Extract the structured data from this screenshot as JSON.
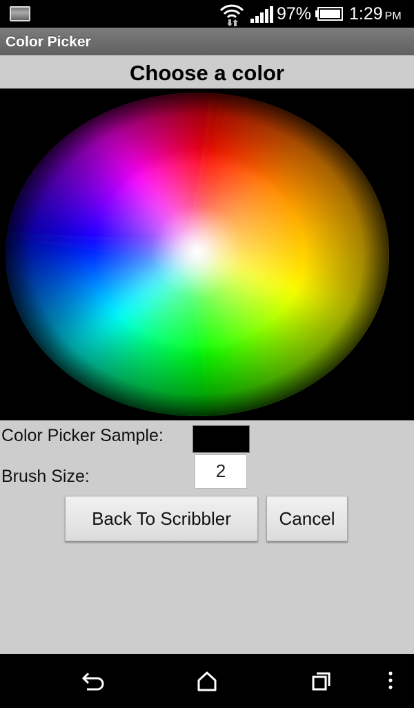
{
  "status_bar": {
    "battery_percent": "97%",
    "time": "1:29",
    "ampm": "PM"
  },
  "app_bar": {
    "title": "Color Picker"
  },
  "main": {
    "heading": "Choose a color",
    "sample_label": "Color Picker Sample:",
    "sample_color": "#000000",
    "brush_size_label": "Brush Size:",
    "brush_size_value": "2",
    "back_button_label": "Back To Scribbler",
    "cancel_button_label": "Cancel"
  },
  "nav_bar": {
    "icons": [
      "back-icon",
      "home-icon",
      "recents-icon",
      "menu-icon"
    ]
  }
}
